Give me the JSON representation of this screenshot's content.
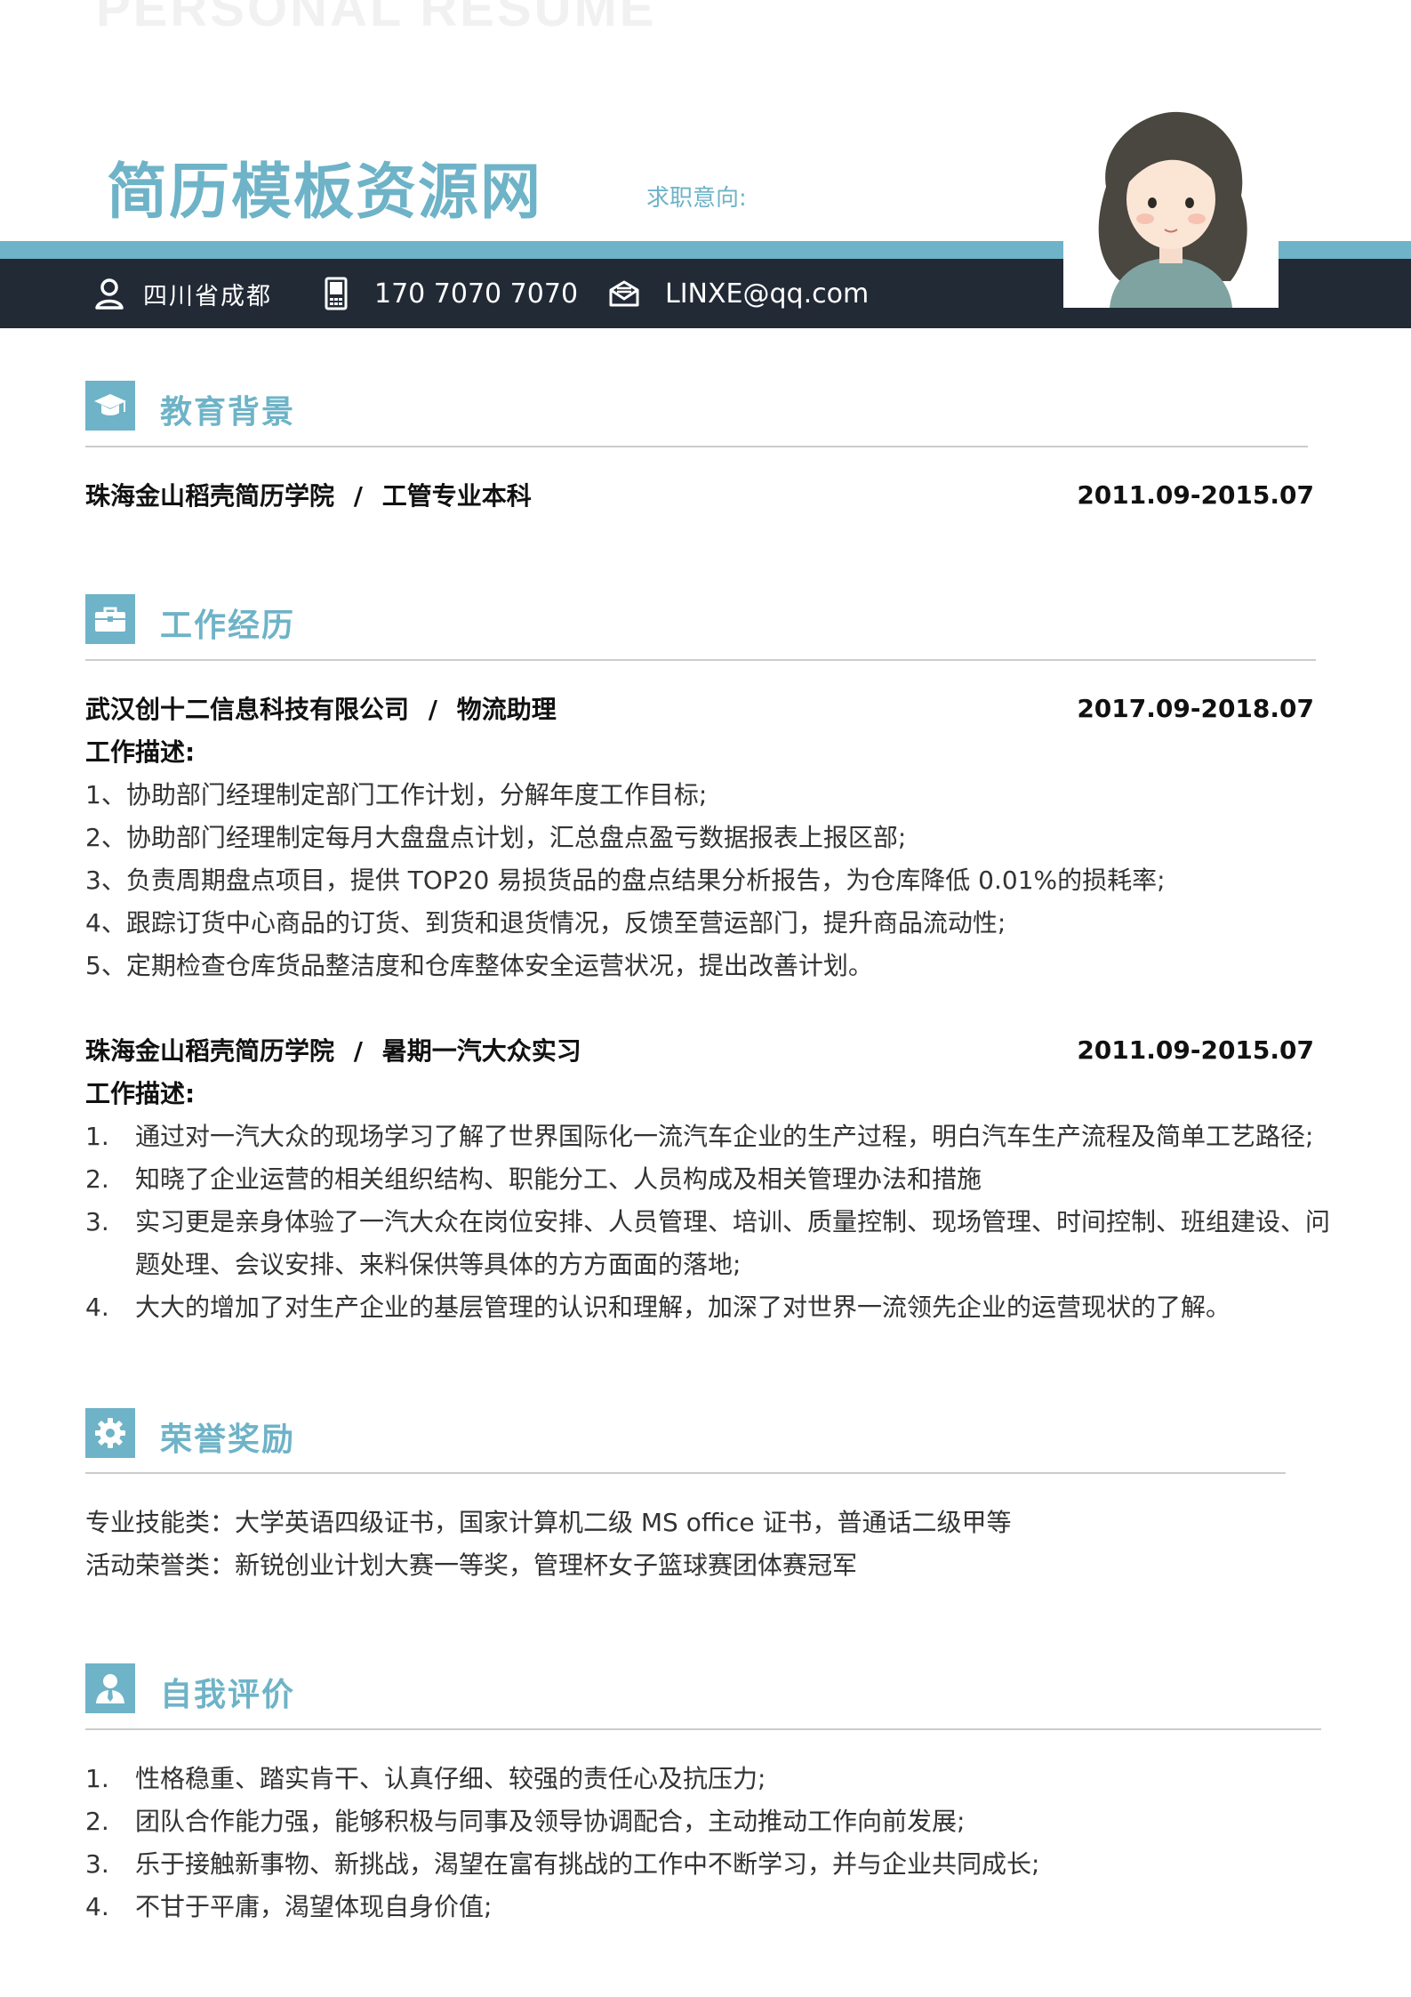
{
  "header": {
    "watermark": "PERSONAL RESUME",
    "name": "简历模板资源网",
    "job_intent": "求职意向:",
    "contact": {
      "location": "四川省成都",
      "phone": "170 7070 7070",
      "email": "LINXE@qq.com"
    }
  },
  "colors": {
    "accent": "#6eb3c7",
    "dark_bar": "#222a36",
    "text": "#333333"
  },
  "icons": {
    "location": "person-pin-icon",
    "phone": "mobile-phone-icon",
    "email": "envelope-icon",
    "education": "graduation-cap-icon",
    "work": "briefcase-icon",
    "honors": "gear-icon",
    "self": "person-tie-icon"
  },
  "education": {
    "title": "教育背景",
    "entries": [
      {
        "school": "珠海金山稻壳简历学院",
        "sep": "/",
        "major": "工管专业本科",
        "date": "2011.09-2015.07"
      }
    ]
  },
  "work": {
    "title": "工作经历",
    "entries": [
      {
        "company": "武汉创十二信息科技有限公司",
        "sep": "/",
        "role": "物流助理",
        "date": "2017.09-2018.07",
        "desc_label": "工作描述:",
        "items": [
          "1、协助部门经理制定部门工作计划，分解年度工作目标;",
          "2、协助部门经理制定每月大盘盘点计划，汇总盘点盈亏数据报表上报区部;",
          "3、负责周期盘点项目，提供 TOP20 易损货品的盘点结果分析报告，为仓库降低 0.01%的损耗率;",
          "4、跟踪订货中心商品的订货、到货和退货情况，反馈至营运部门，提升商品流动性;",
          "5、定期检查仓库货品整洁度和仓库整体安全运营状况，提出改善计划。"
        ]
      },
      {
        "company": "珠海金山稻壳简历学院",
        "sep": "/",
        "role": "暑期一汽大众实习",
        "date": "2011.09-2015.07",
        "desc_label": "工作描述:",
        "items": [
          {
            "n": "1.",
            "text": "通过对一汽大众的现场学习了解了世界国际化一流汽车企业的生产过程，明白汽车生产流程及简单工艺路径;"
          },
          {
            "n": "2.",
            "text": "知晓了企业运营的相关组织结构、职能分工、人员构成及相关管理办法和措施"
          },
          {
            "n": "3.",
            "text": "实习更是亲身体验了一汽大众在岗位安排、人员管理、培训、质量控制、现场管理、时间控制、班组建设、问",
            "cont": "题处理、会议安排、来料保供等具体的方方面面的落地;"
          },
          {
            "n": "4.",
            "text": "大大的增加了对生产企业的基层管理的认识和理解，加深了对世界一流领先企业的运营现状的了解。"
          }
        ]
      }
    ]
  },
  "honors": {
    "title": "荣誉奖励",
    "lines": [
      "专业技能类：大学英语四级证书，国家计算机二级 MS office 证书，普通话二级甲等",
      "活动荣誉类：新锐创业计划大赛一等奖，管理杯女子篮球赛团体赛冠军"
    ]
  },
  "self_eval": {
    "title": "自我评价",
    "items": [
      {
        "n": "1.",
        "text": "性格稳重、踏实肯干、认真仔细、较强的责任心及抗压力;"
      },
      {
        "n": "2.",
        "text": "团队合作能力强，能够积极与同事及领导协调配合，主动推动工作向前发展;"
      },
      {
        "n": "3.",
        "text": "乐于接触新事物、新挑战，渴望在富有挑战的工作中不断学习，并与企业共同成长;"
      },
      {
        "n": "4.",
        "text": "不甘于平庸，渴望体现自身价值;"
      }
    ]
  }
}
